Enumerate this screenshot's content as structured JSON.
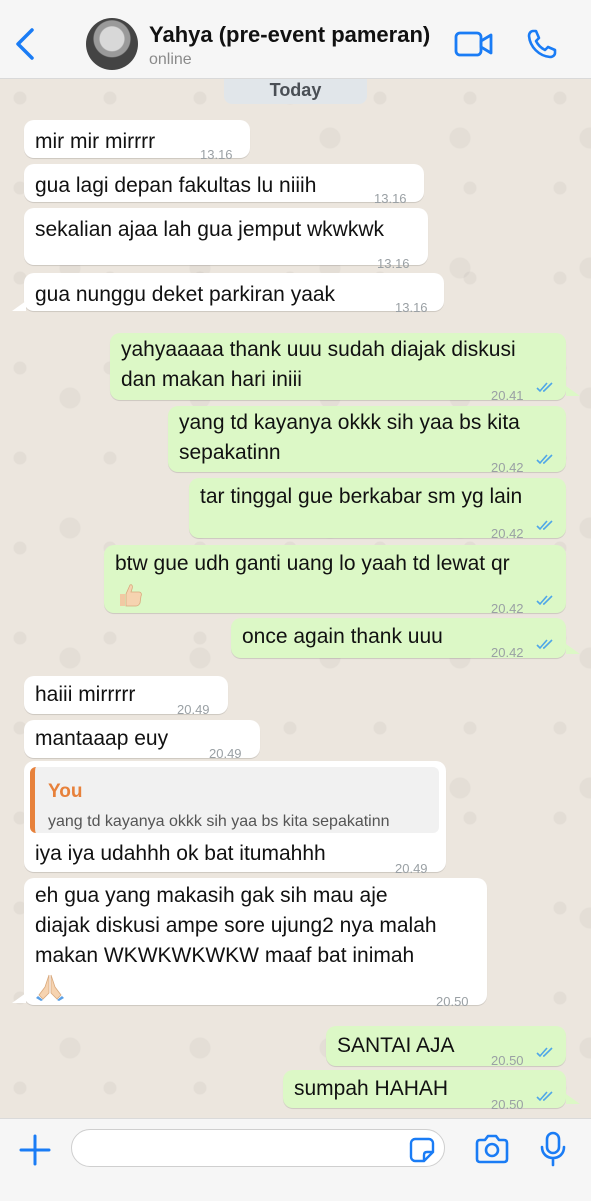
{
  "header": {
    "contact_name": "Yahya (pre-event pameran)",
    "status": "online"
  },
  "date_label": "Today",
  "messages": [
    {
      "dir": "in",
      "text": "mir mir mirrrr",
      "time": "13.16"
    },
    {
      "dir": "in",
      "text": "gua lagi depan fakultas lu niiih",
      "time": "13.16"
    },
    {
      "dir": "in",
      "text": "sekalian ajaa lah gua jemput wkwkwk",
      "time": "13.16"
    },
    {
      "dir": "in",
      "text": "gua nunggu deket parkiran yaak",
      "time": "13.16"
    },
    {
      "dir": "out",
      "lines": [
        "yahyaaaaa thank uuu sudah diajak diskusi",
        "dan makan hari iniii"
      ],
      "time": "20.41",
      "read": true
    },
    {
      "dir": "out",
      "lines": [
        "yang td kayanya okkk sih yaa bs kita",
        "sepakatinn"
      ],
      "time": "20.42",
      "read": true
    },
    {
      "dir": "out",
      "text": "tar tinggal gue berkabar sm yg lain",
      "time": "20.42",
      "read": true
    },
    {
      "dir": "out",
      "text": "btw gue udh ganti uang lo yaah td lewat qr",
      "emoji": "thumbs-up-icon",
      "time": "20.42",
      "read": true
    },
    {
      "dir": "out",
      "text": "once again thank uuu",
      "time": "20.42",
      "read": true
    },
    {
      "dir": "in",
      "text": "haiii mirrrrr",
      "time": "20.49"
    },
    {
      "dir": "in",
      "text": "mantaaap euy",
      "time": "20.49"
    },
    {
      "dir": "in",
      "quote_name": "You",
      "quote_text": "yang td kayanya okkk sih yaa bs kita sepakatinn",
      "text": "iya iya udahhh ok bat itumahhh",
      "time": "20.49"
    },
    {
      "dir": "in",
      "lines": [
        "eh gua yang makasih gak sih mau aje",
        "diajak diskusi ampe sore ujung2 nya malah",
        "makan WKWKWKWKW maaf bat inimah"
      ],
      "emoji": "folded-hands-icon",
      "time": "20.50"
    },
    {
      "dir": "out",
      "text": "SANTAI AJA",
      "time": "20.50",
      "read": true
    },
    {
      "dir": "out",
      "text": "sumpah HAHAH",
      "time": "20.50",
      "read": true
    }
  ],
  "composer": {
    "placeholder": ""
  },
  "colors": {
    "accent": "#1a7cf5",
    "outgoing_bubble": "#dcf8c6",
    "incoming_bubble": "#ffffff",
    "read_ticks": "#4fa6e8",
    "quote_accent": "#e7813b"
  }
}
